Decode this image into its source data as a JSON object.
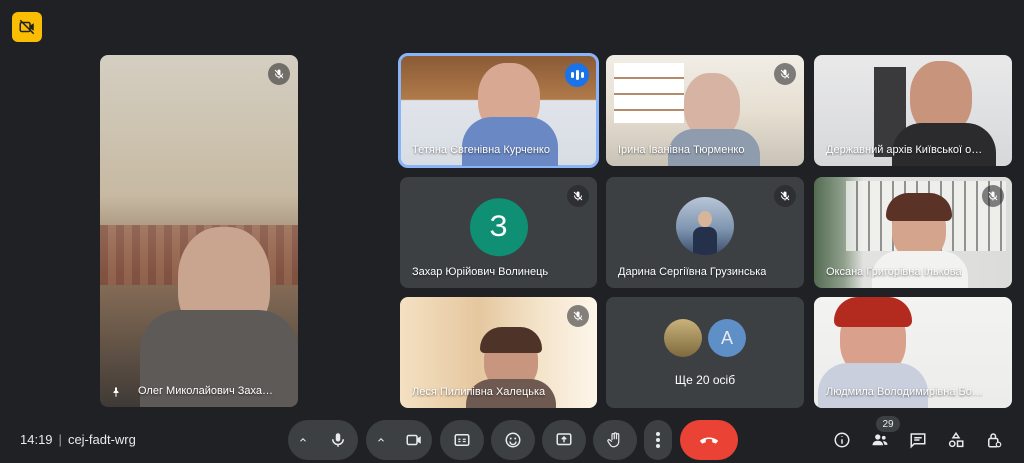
{
  "participants": {
    "pinned": {
      "name": "Олег Миколайович Заха…"
    },
    "tile1": {
      "name": "Тетяна Євгенівна Курченко"
    },
    "tile2": {
      "name": "Ірина Іванівна Тюрменко"
    },
    "tile3": {
      "name": "Державний архів Київської о…"
    },
    "tile4": {
      "name": "Захар Юрійович Волинець",
      "initial": "З"
    },
    "tile5": {
      "name": "Дарина Сергіївна Грузинська"
    },
    "tile6": {
      "name": "Оксана Григорівна Ількова"
    },
    "tile7": {
      "name": "Леся Пилипівна Халецька"
    },
    "tile8": {
      "more_label": "Ще 20 осіб",
      "initial": "А"
    },
    "tile9": {
      "name": "Людмила Володимирівна Бо…"
    }
  },
  "meeting": {
    "time": "14:19",
    "code": "cej-fadt-wrg"
  },
  "people_count": "29",
  "colors": {
    "accent": "#8ab4f8",
    "end_call": "#ea4335",
    "record": "#fbbc04",
    "avatar_green": "#0f8f73",
    "avatar_blue": "#5f8fc7"
  }
}
